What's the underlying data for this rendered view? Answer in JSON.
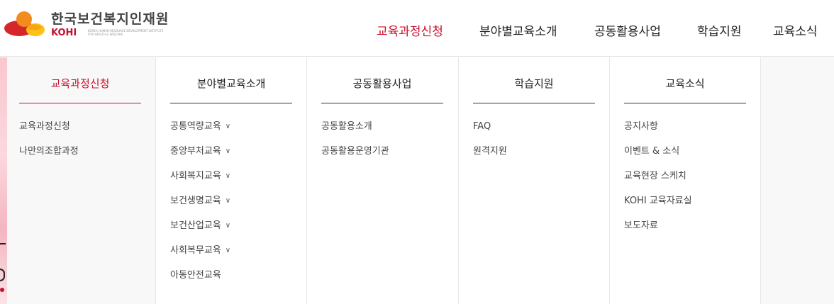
{
  "logo": {
    "name": "한국보건복지인재원",
    "abbr": "KOHI",
    "tagline_1": "KOREA HUMAN RESOURCE DEVELOPMENT INSTITUTE",
    "tagline_2": "FOR HEALTH & WELFARE",
    "colors": {
      "red": "#d7262b",
      "orange": "#f28c1f",
      "yellow": "#ffc20e"
    }
  },
  "gnb": [
    {
      "label": "교육과정신청",
      "active": true
    },
    {
      "label": "분야별교육소개",
      "active": false
    },
    {
      "label": "공동활용사업",
      "active": false
    },
    {
      "label": "학습지원",
      "active": false
    },
    {
      "label": "교육소식",
      "active": false
    }
  ],
  "mega": {
    "columns": [
      {
        "title": "교육과정신청",
        "active": true,
        "items": [
          {
            "label": "교육과정신청"
          },
          {
            "label": "나만의조합과정"
          }
        ]
      },
      {
        "title": "분야별교육소개",
        "active": false,
        "items": [
          {
            "label": "공통역량교육",
            "expand": true
          },
          {
            "label": "중앙부처교육",
            "expand": true
          },
          {
            "label": "사회복지교육",
            "expand": true
          },
          {
            "label": "보건생명교육",
            "expand": true
          },
          {
            "label": "보건산업교육",
            "expand": true
          },
          {
            "label": "사회복무교육",
            "expand": true
          },
          {
            "label": "아동안전교육",
            "expand": false
          }
        ]
      },
      {
        "title": "공동활용사업",
        "active": false,
        "items": [
          {
            "label": "공동활용소개"
          },
          {
            "label": "공동활용운영기관"
          }
        ]
      },
      {
        "title": "학습지원",
        "active": false,
        "items": [
          {
            "label": "FAQ"
          },
          {
            "label": "원격지원"
          }
        ]
      },
      {
        "title": "교육소식",
        "active": false,
        "items": [
          {
            "label": "공지사항"
          },
          {
            "label": "이벤트 & 소식"
          },
          {
            "label": "교육현장 스케치"
          },
          {
            "label": "KOHI 교육자료실"
          },
          {
            "label": "보도자료"
          }
        ]
      }
    ]
  },
  "icons": {
    "chevron": "chevron-down-icon"
  },
  "accent": "#c8102e"
}
